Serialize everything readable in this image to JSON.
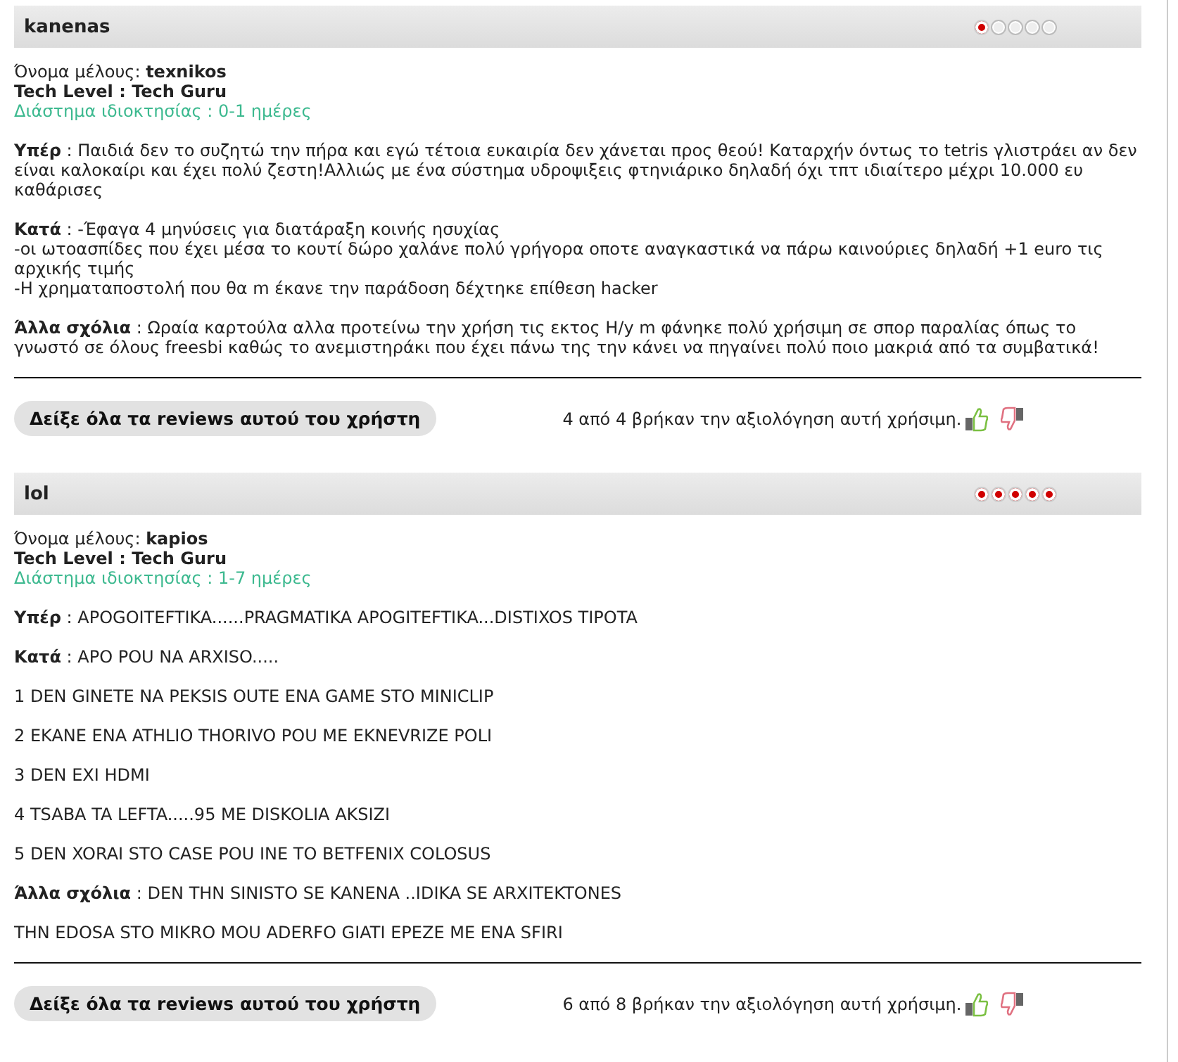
{
  "reviews": [
    {
      "title": "kanenas",
      "stars": 1,
      "member": "Όνομα μέλους: **texnikos**",
      "tech_level": "Tech Level : Tech Guru",
      "ownership": "Διάστημα ιδιοκτησίας : 0-1 ημέρες",
      "paragraphs": [
        {
          "lines": [
            "**Υπέρ** : Παιδιά δεν το συζητώ την πήρα και εγώ τέτοια ευκαιρία δεν χάνεται προς θεού! Καταρχήν όντως το tetris γλιστράει αν δεν είναι καλοκαίρι και έχει πολύ ζεστη!Αλλιώς με ένα σύστημα υδροψιξεις φτηνιάρικο δηλαδή όχι τπτ ιδιαίτερο μέχρι 10.000 ευ καθάρισες"
          ]
        },
        {
          "lines": [
            "**Κατά** : -Έφαγα 4 μηνύσεις για διατάραξη κοινής ησυχίας",
            "-οι ωτοασπίδες που έχει μέσα το κουτί δώρο χαλάνε πολύ γρήγορα οποτε αναγκαστικά να πάρω καινούριες δηλαδή +1 euro τις αρχικής τιμής",
            "-Η χρηματαποστολή που θα m έκανε την παράδοση δέχτηκε επίθεση hacker"
          ]
        },
        {
          "lines": [
            "**Άλλα σχόλια** : Ωραία καρτούλα αλλα προτείνω την χρήση τις εκτος Η/y m φάνηκε πολύ χρήσιμη σε σπορ παραλίας όπως το γνωστό σε όλους freesbi καθώς το ανεμιστηράκι που έχει πάνω της την κάνει να πηγαίνει πολύ ποιο μακριά από τα συμβατικά!"
          ]
        }
      ],
      "button": "Δείξε όλα τα reviews αυτού του χρήστη",
      "helpful": "4 από 4 βρήκαν την αξιολόγηση αυτή χρήσιμη."
    },
    {
      "title": "lol",
      "stars": 5,
      "member": "Όνομα μέλους: **kapios**",
      "tech_level": "Tech Level : Tech Guru",
      "ownership": "Διάστημα ιδιοκτησίας : 1-7 ημέρες",
      "paragraphs": [
        {
          "lines": [
            "**Υπέρ** : APOGOITEFTIKA......PRAGMATIKA APOGITEFTIKA...DISTIXOS TIPOTA"
          ]
        },
        {
          "lines": [
            "**Κατά** : APO POU NA ARXISO....."
          ]
        },
        {
          "lines": [
            "1 DEN GINETE NA PEKSIS OUTE ENA GAME STO MINICLIP"
          ]
        },
        {
          "lines": [
            "2 EKANE ENA ATHLIO THORIVO POU ME EKNEVRIZE POLI"
          ]
        },
        {
          "lines": [
            "3 DEN EXI HDMI"
          ]
        },
        {
          "lines": [
            "4 TSABA TA LEFTA.....95 ME DISKOLIA AKSIZI"
          ]
        },
        {
          "lines": [
            "5 DEN XORAI STO CASE POU INE TO BETFENIX COLOSUS"
          ]
        },
        {
          "lines": [
            "**Άλλα σχόλια** : DEN THN SINISTO SE KANENA ..IDIKA SE ARXITEKTONES"
          ]
        },
        {
          "lines": [
            "THN EDOSA STO MIKRO MOU ADERFO GIATI EPEZE ME ENA SFIRI"
          ]
        }
      ],
      "button": "Δείξε όλα τα reviews αυτού του χρήστη",
      "helpful": "6 από 8 βρήκαν την αξιολόγηση αυτή χρήσιμη."
    }
  ]
}
